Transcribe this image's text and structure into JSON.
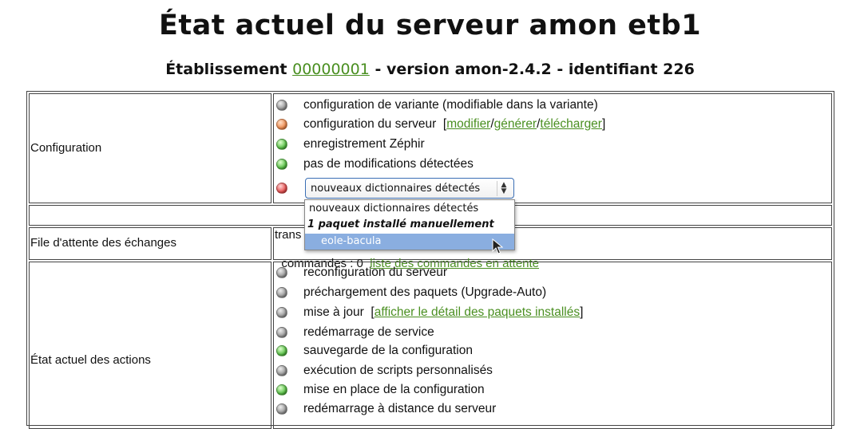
{
  "header": {
    "title": "État actuel du serveur amon etb1",
    "subtitle_prefix": "Établissement ",
    "etab_link": "00000001",
    "subtitle_suffix": " - version amon-2.4.2 - identifiant 226"
  },
  "configuration": {
    "label": "Configuration",
    "items": [
      {
        "status": "gray",
        "text": "configuration de variante  (modifiable dans la variante)"
      },
      {
        "status": "orange",
        "text": "configuration du serveur  ",
        "links": [
          "modifier",
          "générer",
          "télécharger"
        ]
      },
      {
        "status": "green",
        "text": "enregistrement Zéphir"
      },
      {
        "status": "green",
        "text": "pas de modifications détectées"
      },
      {
        "status": "red"
      }
    ],
    "select": {
      "value": "nouveaux dictionnaires détectés",
      "options": [
        {
          "text": "nouveaux dictionnaires détectés",
          "type": "option"
        },
        {
          "text": "1 paquet installé manuellement",
          "type": "group"
        },
        {
          "text": "eole-bacula",
          "type": "option",
          "selected": true
        }
      ]
    }
  },
  "queue": {
    "label": "File d'attente des échanges",
    "line1": "trans",
    "line2_prefix": "commandes : 0  ",
    "line2_link": "liste des commandes en attente"
  },
  "actions": {
    "label": "État actuel des actions",
    "items": [
      {
        "status": "gray",
        "text": "reconfiguration du serveur"
      },
      {
        "status": "gray",
        "text": "préchargement des paquets (Upgrade-Auto)"
      },
      {
        "status": "gray",
        "text": "mise à jour  ",
        "link": "afficher le détail des paquets installés"
      },
      {
        "status": "gray",
        "text": "redémarrage de service"
      },
      {
        "status": "green",
        "text": "sauvegarde de la configuration"
      },
      {
        "status": "gray",
        "text": "exécution de scripts personnalisés"
      },
      {
        "status": "green",
        "text": "mise en place de la configuration"
      },
      {
        "status": "gray",
        "text": "redémarrage à distance du serveur"
      }
    ]
  },
  "colors": {
    "link": "#4a8f21",
    "selected_option": "#8aaee0"
  }
}
